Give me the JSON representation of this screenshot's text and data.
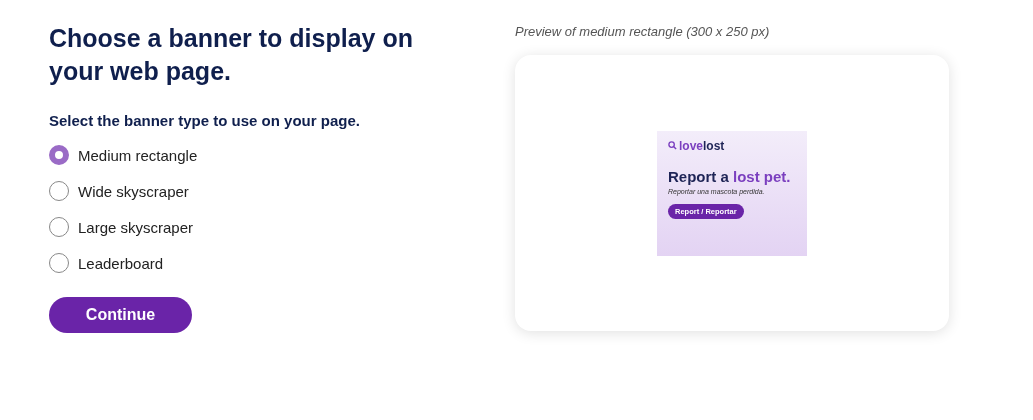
{
  "heading": "Choose a banner to display on your web page.",
  "prompt": "Select the banner type to use on your page.",
  "options": [
    {
      "label": "Medium rectangle",
      "selected": true
    },
    {
      "label": "Wide skyscraper",
      "selected": false
    },
    {
      "label": "Large skyscraper",
      "selected": false
    },
    {
      "label": "Leaderboard",
      "selected": false
    }
  ],
  "continue_button": "Continue",
  "preview": {
    "caption": "Preview of medium rectangle (300 x 250 px)",
    "banner": {
      "logo": [
        "love",
        "lost"
      ],
      "headline": [
        "Report a ",
        "lost pet."
      ],
      "subtext": "Reportar una mascota perdida.",
      "button": "Report / Reportar"
    }
  }
}
